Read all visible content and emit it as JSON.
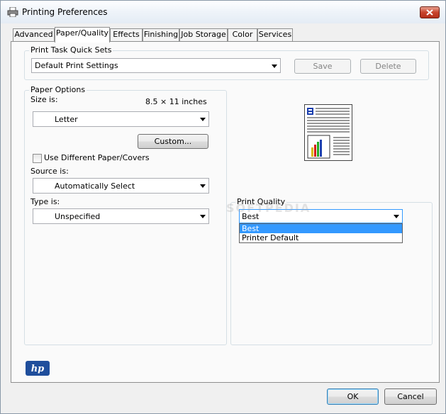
{
  "window": {
    "title": "Printing Preferences",
    "icon": "printer-icon"
  },
  "tabs": [
    {
      "label": "Advanced",
      "active": false
    },
    {
      "label": "Paper/Quality",
      "active": true
    },
    {
      "label": "Effects",
      "active": false
    },
    {
      "label": "Finishing",
      "active": false
    },
    {
      "label": "Job Storage",
      "active": false
    },
    {
      "label": "Color",
      "active": false
    },
    {
      "label": "Services",
      "active": false
    }
  ],
  "quick_sets": {
    "legend": "Print Task Quick Sets",
    "selected": "Default Print Settings",
    "save_label": "Save",
    "delete_label": "Delete"
  },
  "paper_options": {
    "legend": "Paper Options",
    "size_label": "Size is:",
    "size_dims": "8.5 × 11 inches",
    "size_value": "Letter",
    "custom_label": "Custom...",
    "different_paper_label": "Use Different Paper/Covers",
    "different_paper_checked": false,
    "source_label": "Source is:",
    "source_value": "Automatically Select",
    "type_label": "Type is:",
    "type_value": "Unspecified"
  },
  "print_quality": {
    "legend": "Print Quality",
    "selected": "Best",
    "options": [
      "Best",
      "Printer Default"
    ]
  },
  "footer": {
    "ok_label": "OK",
    "cancel_label": "Cancel"
  },
  "logo": "hp",
  "watermark": "SOFTPEDIA",
  "colors": {
    "selection": "#3399ff",
    "close_button": "#c8442c",
    "hp_blue": "#1f4e9c"
  }
}
